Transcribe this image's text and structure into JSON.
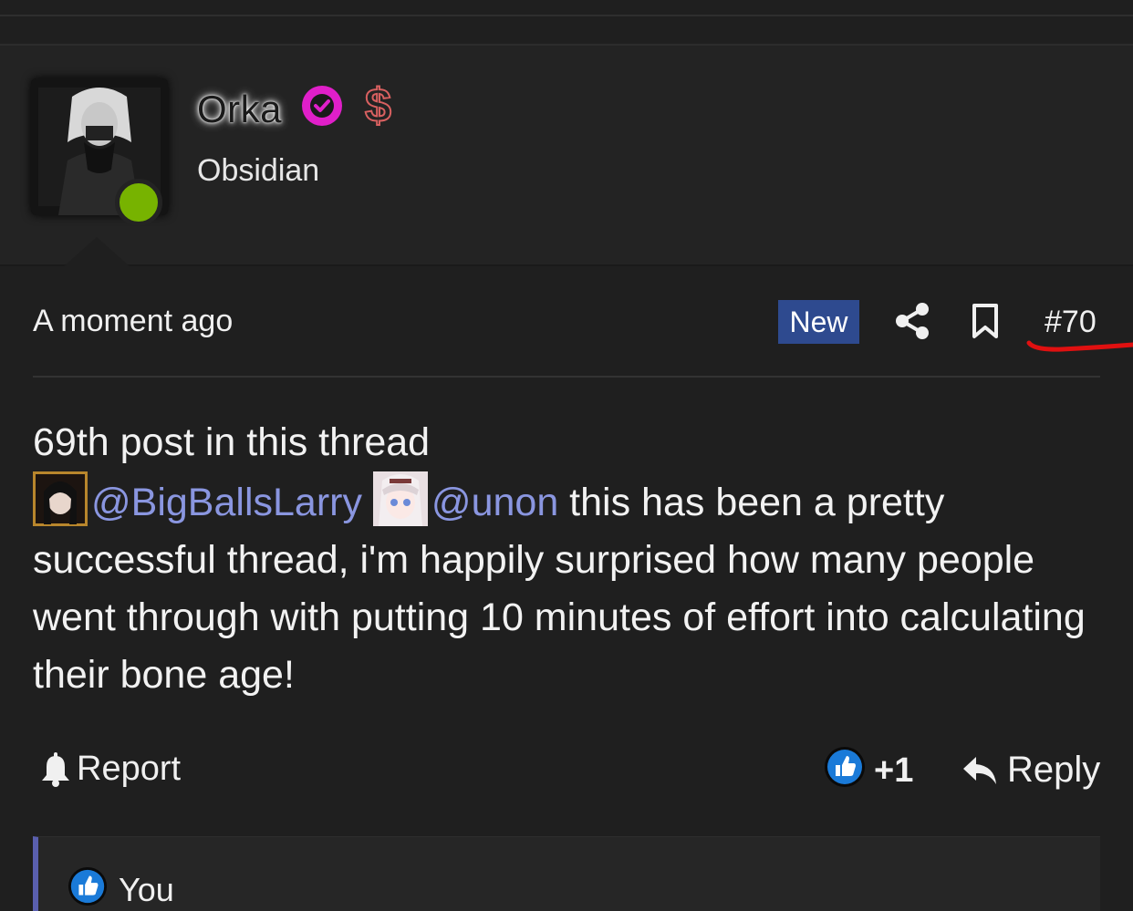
{
  "user": {
    "name": "Orka",
    "title": "Obsidian",
    "verified_color": "#e01fc9",
    "online_color": "#77b300"
  },
  "post_meta": {
    "timestamp": "A moment ago",
    "new_badge": "New",
    "post_number": "#70"
  },
  "post": {
    "line1": "69th post in this thread",
    "mention1": "@BigBallsLarry",
    "mention2": "@unon",
    "text_rest": " this has been a pretty successful thread, i'm happily surprised how many people went through with putting 10 minutes of effort into calculating their bone age!"
  },
  "actions": {
    "report_label": "Report",
    "like_count": "+1",
    "reply_label": "Reply"
  },
  "reactions": {
    "label": "You"
  },
  "icons": [
    "verified-icon",
    "dollar-icon",
    "share-icon",
    "bookmark-icon",
    "bell-icon",
    "like-icon",
    "reply-icon"
  ],
  "colors": {
    "background": "#1f1f1f",
    "badge_bg": "#2e4a8f",
    "mention": "#8a96e0",
    "like_blue": "#1a7ad8",
    "annotation_red": "#e01010"
  }
}
